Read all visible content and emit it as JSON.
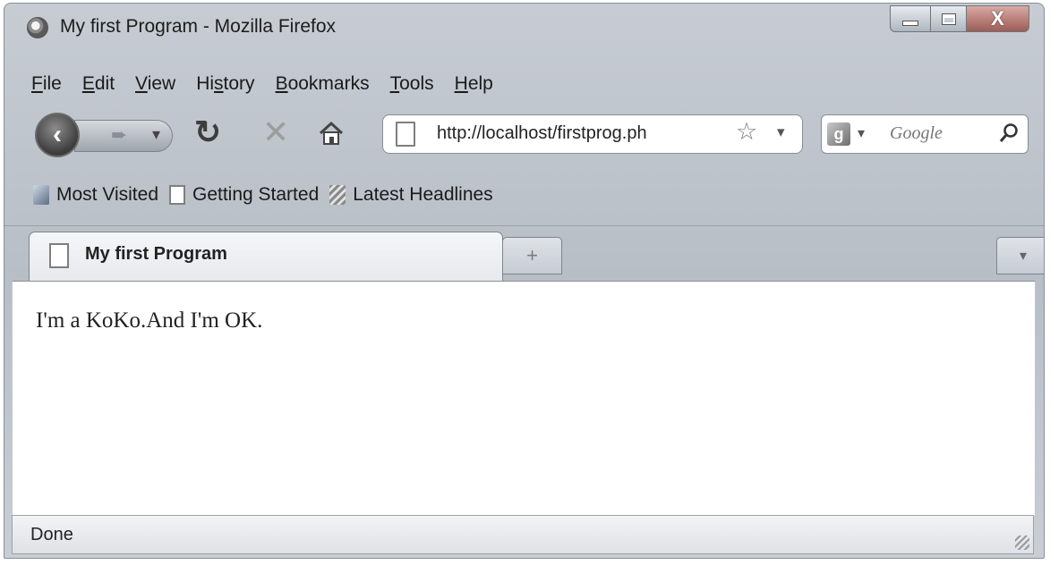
{
  "window": {
    "title": "My first Program - Mozilla Firefox",
    "close_glyph": "X"
  },
  "menubar": {
    "items": [
      {
        "key": "F",
        "rest": "ile"
      },
      {
        "key": "E",
        "rest": "dit"
      },
      {
        "key": "V",
        "rest": "iew"
      },
      {
        "pre": "Hi",
        "key": "s",
        "rest": "tory"
      },
      {
        "key": "B",
        "rest": "ookmarks"
      },
      {
        "key": "T",
        "rest": "ools"
      },
      {
        "key": "H",
        "rest": "elp"
      }
    ]
  },
  "navbar": {
    "url": "http://localhost/firstprog.ph",
    "search_placeholder": "Google",
    "icons": [
      "back-icon",
      "forward-icon",
      "reload-icon",
      "stop-icon",
      "home-icon",
      "bookmark-star-icon",
      "search-icon"
    ]
  },
  "bookmarks": {
    "items": [
      {
        "label": "Most Visited",
        "icon": "most-visited-icon"
      },
      {
        "label": "Getting Started",
        "icon": "page-icon"
      },
      {
        "label": "Latest Headlines",
        "icon": "rss-icon"
      }
    ]
  },
  "tabs": {
    "items": [
      {
        "label": "My first Program",
        "active": true
      }
    ],
    "new_tab_glyph": "+"
  },
  "content": {
    "text": "I'm a KoKo.And I'm OK."
  },
  "statusbar": {
    "text": "Done"
  }
}
